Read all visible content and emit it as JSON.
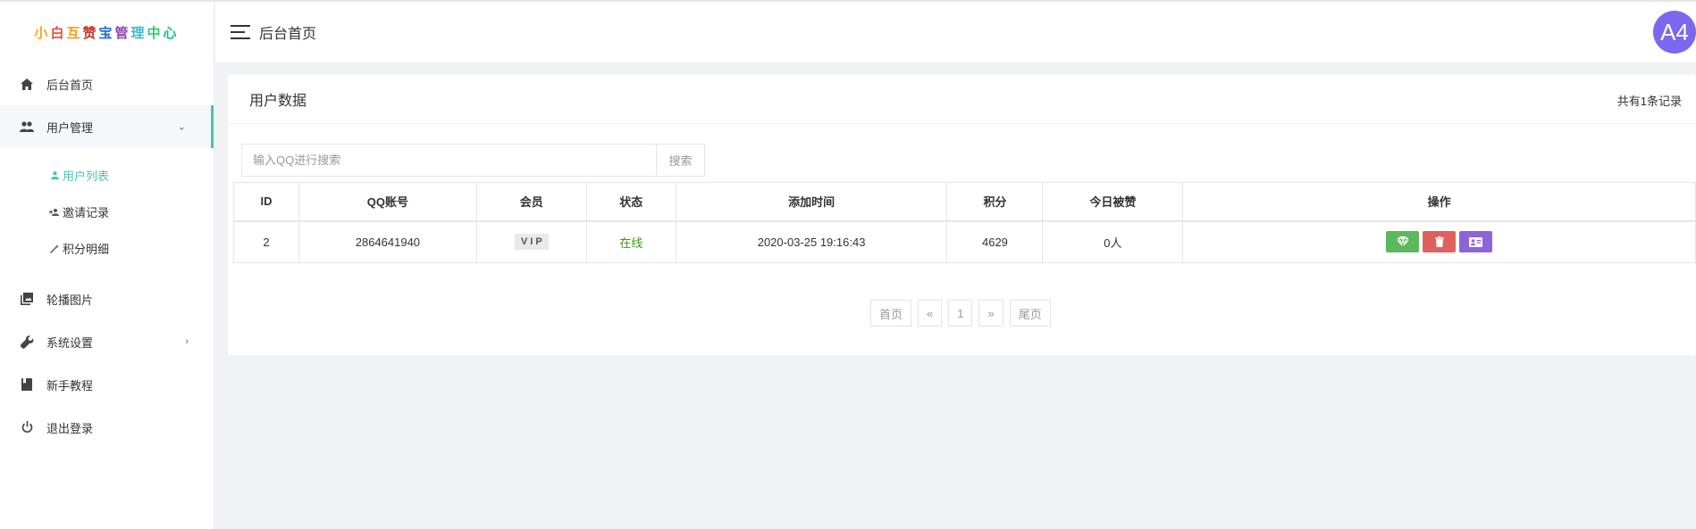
{
  "logo": {
    "chars": [
      "小",
      "白",
      "互",
      "赞",
      "宝",
      "管",
      "理",
      "中",
      "心"
    ],
    "colors": [
      "#f5a623",
      "#e84c3d",
      "#f39c12",
      "#c0392b",
      "#2c6bd6",
      "#8e44ad",
      "#3fb9c9",
      "#2ecc71",
      "#1abc9c"
    ]
  },
  "sidebar": {
    "items": [
      {
        "label": "后台首页",
        "icon": "home-icon"
      },
      {
        "label": "用户管理",
        "icon": "users-icon",
        "arrow": "⌄"
      },
      {
        "label": "轮播图片",
        "icon": "image-icon"
      },
      {
        "label": "系统设置",
        "icon": "wrench-icon",
        "arrow": "›"
      },
      {
        "label": "新手教程",
        "icon": "book-icon"
      },
      {
        "label": "退出登录",
        "icon": "power-icon"
      }
    ],
    "sub_items": [
      {
        "label": "用户列表",
        "icon": "user-icon",
        "active": true
      },
      {
        "label": "邀请记录",
        "icon": "user-add-icon"
      },
      {
        "label": "积分明细",
        "icon": "wand-icon"
      }
    ]
  },
  "header": {
    "title": "后台首页",
    "avatar_text": "A4",
    "avatar_color": "#7b68ee"
  },
  "card": {
    "title": "用户数据",
    "count_text": "共有1条记录"
  },
  "search": {
    "placeholder": "输入QQ进行搜索",
    "button": "搜索"
  },
  "table": {
    "headers": [
      "ID",
      "QQ账号",
      "会员",
      "状态",
      "添加时间",
      "积分",
      "今日被赞",
      "操作"
    ],
    "rows": [
      {
        "id": "2",
        "qq": "2864641940",
        "member": "VIP",
        "status": "在线",
        "added": "2020-03-25 19:16:43",
        "points": "4629",
        "likes_today": "0人"
      }
    ]
  },
  "pager": {
    "first": "首页",
    "prev": "«",
    "current": "1",
    "next": "»",
    "last": "尾页"
  },
  "colors": {
    "accent": "#4cc3a8",
    "btn_green": "#5cb85c",
    "btn_red": "#e0605d",
    "btn_purple": "#8e63d8",
    "online": "#3b9b11"
  }
}
